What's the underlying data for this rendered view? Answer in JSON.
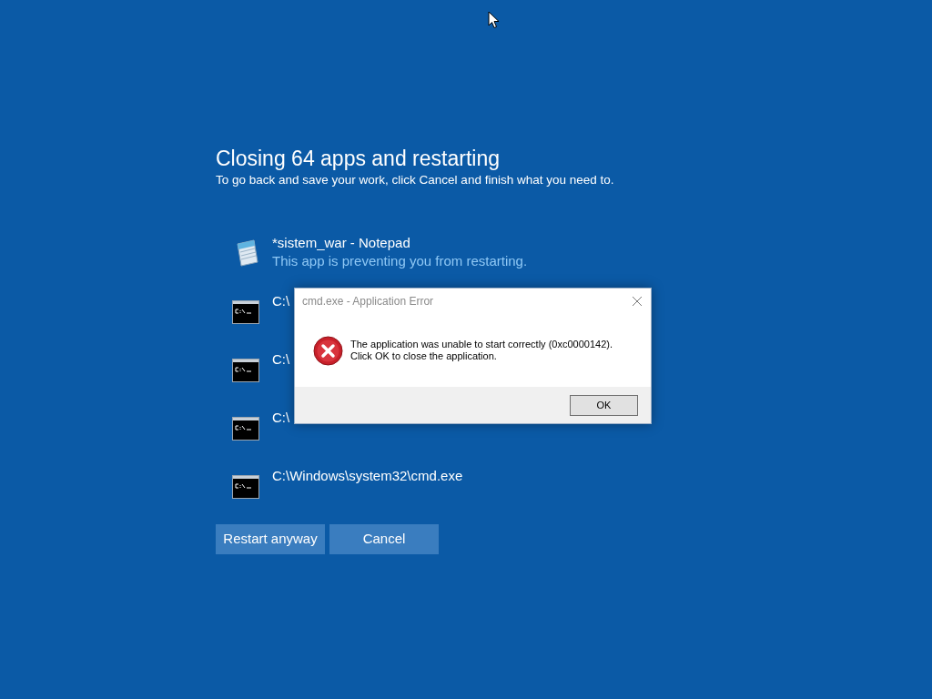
{
  "title": "Closing 64 apps and restarting",
  "subtitle": "To go back and save your work, click Cancel and finish what you need to.",
  "apps": [
    {
      "kind": "notepad",
      "name": "*sistem_war - Notepad",
      "status": "This app is preventing you from restarting."
    },
    {
      "kind": "cmd",
      "name": "C:\\"
    },
    {
      "kind": "cmd",
      "name": "C:\\"
    },
    {
      "kind": "cmd",
      "name": "C:\\"
    },
    {
      "kind": "cmd",
      "name": "C:\\Windows\\system32\\cmd.exe"
    }
  ],
  "buttons": [
    {
      "label": "Restart anyway"
    },
    {
      "label": "Cancel"
    }
  ],
  "dialog": {
    "title": "cmd.exe - Application Error",
    "message_lines": [
      "The application was unable to start correctly (0xc0000142).",
      "Click OK to close the application."
    ],
    "button": "OK"
  }
}
